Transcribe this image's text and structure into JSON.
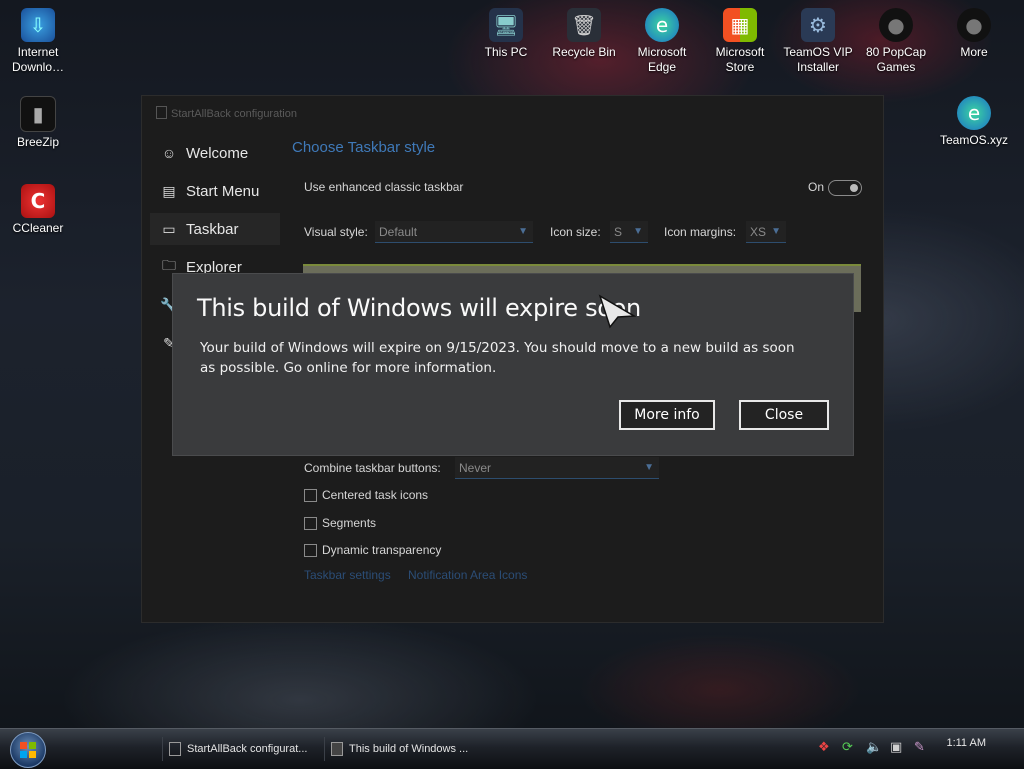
{
  "desktop": {
    "icons_left": [
      {
        "label": "Internet\nDownlo…",
        "icon": "internet-download-icon"
      },
      {
        "label": "BreeZip",
        "icon": "breezip-icon"
      },
      {
        "label": "CCleaner",
        "icon": "ccleaner-icon"
      }
    ],
    "icons_top": [
      {
        "label": "This PC"
      },
      {
        "label": "Recycle Bin"
      },
      {
        "label": "Microsoft\nEdge"
      },
      {
        "label": "Microsoft\nStore"
      },
      {
        "label": "TeamOS VIP\nInstaller"
      },
      {
        "label": "80 PopCap\nGames"
      },
      {
        "label": "More"
      }
    ],
    "icon_right": {
      "label": "TeamOS.xyz"
    }
  },
  "sab_window": {
    "title": "StartAllBack configuration",
    "nav": [
      {
        "label": "Welcome",
        "icon": "smiley-icon"
      },
      {
        "label": "Start Menu",
        "icon": "start-menu-icon"
      },
      {
        "label": "Taskbar",
        "icon": "taskbar-icon"
      },
      {
        "label": "Explorer",
        "icon": "folder-icon"
      }
    ],
    "heading": "Choose Taskbar style",
    "enhanced_label": "Use enhanced classic taskbar",
    "enhanced_state": "On",
    "visual_style_label": "Visual style:",
    "visual_style_value": "Default",
    "icon_size_label": "Icon size:",
    "icon_size_value": "S",
    "icon_margins_label": "Icon margins:",
    "icon_margins_value": "XS",
    "combine_label": "Combine taskbar buttons:",
    "combine_value": "Never",
    "checkboxes": [
      "Centered task icons",
      "Segments",
      "Dynamic transparency"
    ],
    "links": [
      "Taskbar settings",
      "Notification Area Icons"
    ]
  },
  "dialog": {
    "title": "This build of Windows will expire soon",
    "body": "Your build of Windows will expire on 9/15/2023. You should move to a new build as soon as possible. Go online for more information.",
    "more_info": "More info",
    "close": "Close"
  },
  "taskbar": {
    "buttons": [
      "StartAllBack configurat...",
      "This build of Windows ..."
    ],
    "clock": "1:11 AM"
  },
  "colors": {
    "accent_link": "#3f79b8",
    "dialog_bg": "#3a3b3d"
  }
}
